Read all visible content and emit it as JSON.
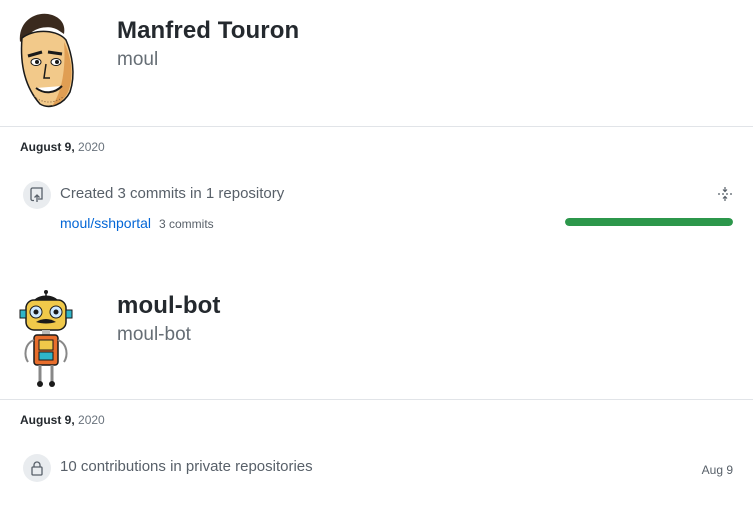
{
  "profiles": [
    {
      "name": "Manfred Touron",
      "login": "moul",
      "avatar_icon": "cartoon-face-avatar",
      "date_md": "August 9,",
      "date_year": "2020",
      "event": {
        "icon": "repo-push-icon",
        "text": "Created 3 commits in 1 repository",
        "repo": "moul/sshportal",
        "commits": "3 commits",
        "progress": 1.0,
        "progress_color": "#2c974b"
      }
    },
    {
      "name": "moul-bot",
      "login": "moul-bot",
      "avatar_icon": "robot-avatar",
      "date_md": "August 9,",
      "date_year": "2020",
      "event": {
        "icon": "lock-icon",
        "text": "10 contributions in private repositories",
        "date": "Aug 9"
      }
    }
  ]
}
